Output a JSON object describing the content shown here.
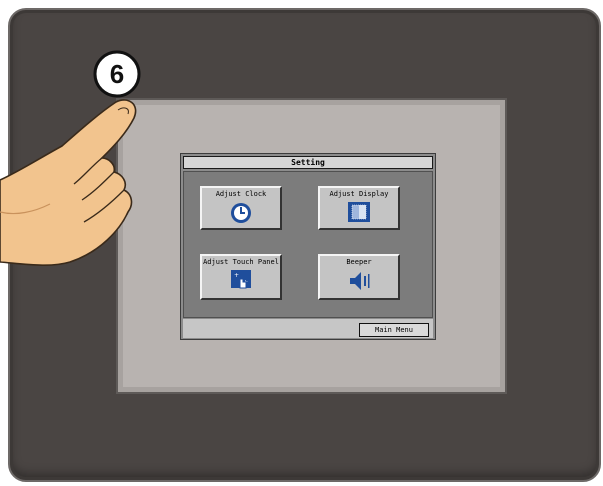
{
  "callout": {
    "number": "6"
  },
  "screen": {
    "title": "Setting",
    "buttons": [
      {
        "label": "Adjust Clock",
        "icon": "clock-icon"
      },
      {
        "label": "Adjust Display",
        "icon": "display-icon"
      },
      {
        "label": "Adjust Touch Panel",
        "icon": "touch-panel-icon"
      },
      {
        "label": "Beeper",
        "icon": "speaker-icon"
      }
    ],
    "footer_button": "Main Menu"
  },
  "colors": {
    "bezel": "#4a4543",
    "glass": "#b8b3b0",
    "icon_blue": "#1f4e9c",
    "skin": "#f2c48e"
  }
}
